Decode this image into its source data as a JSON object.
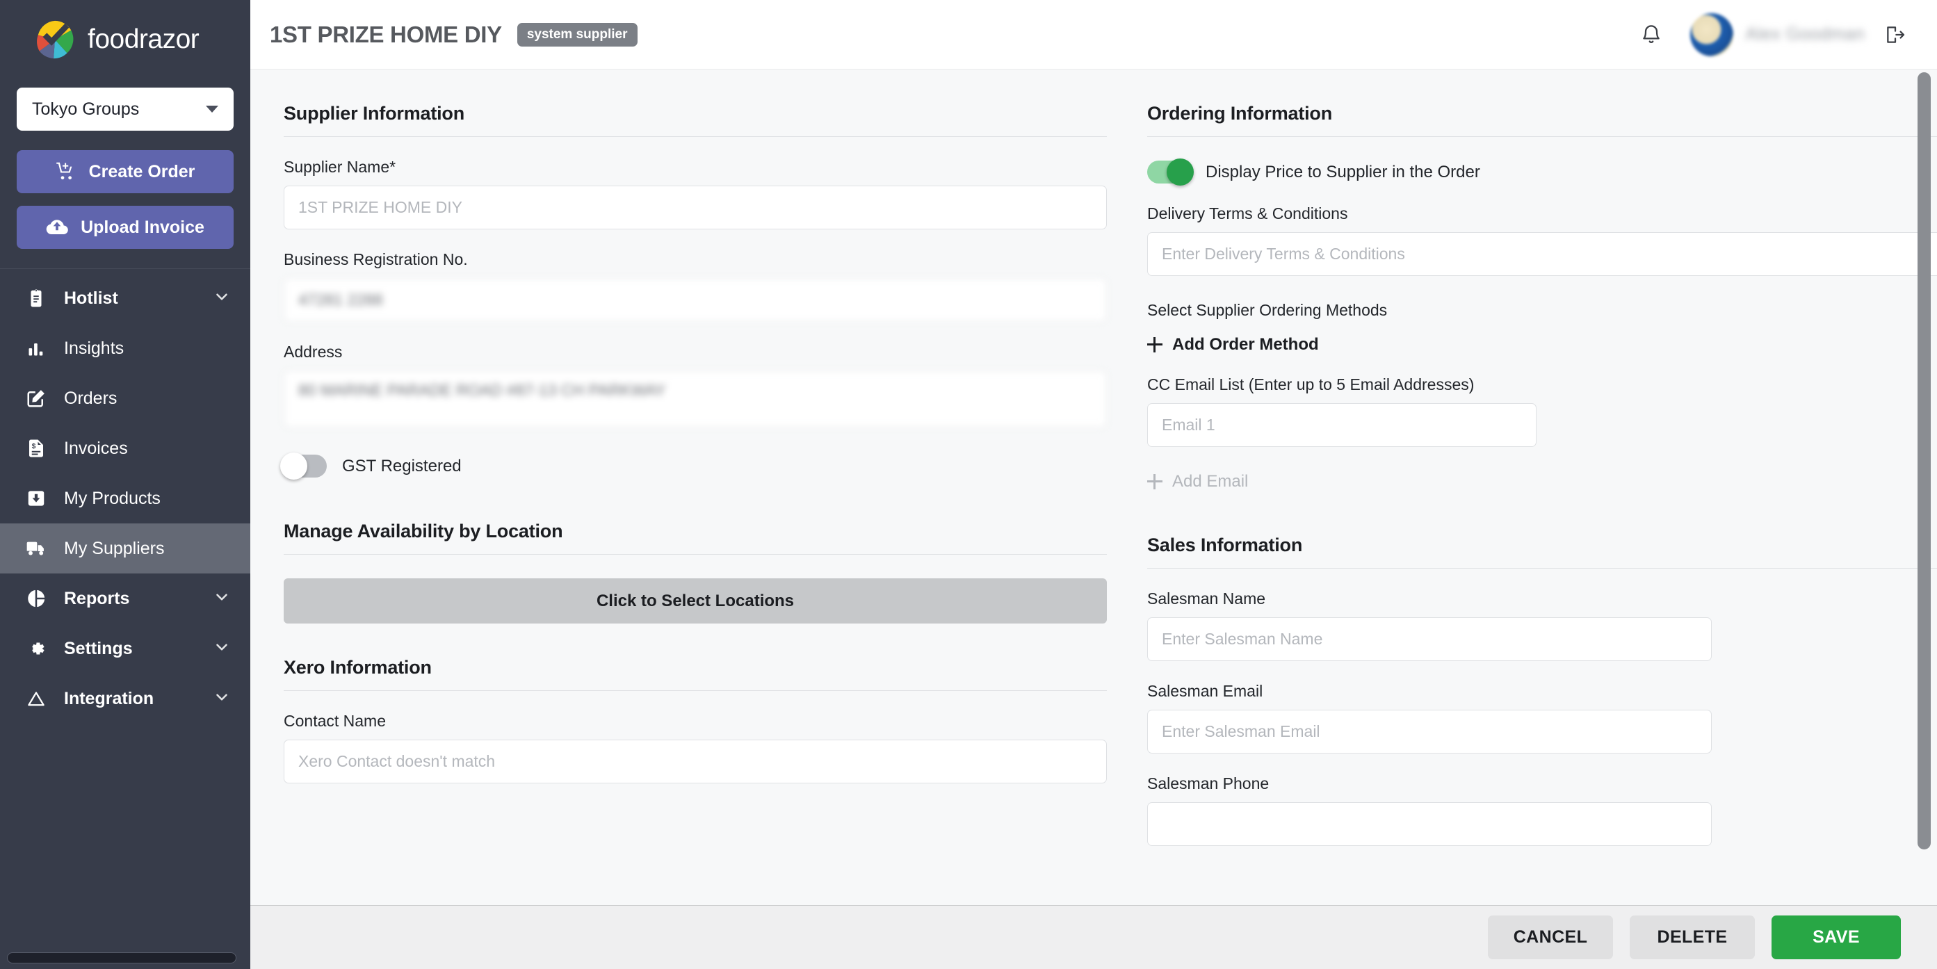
{
  "brand": {
    "name": "foodrazor",
    "logo_icon": "foodrazor-pinwheel-logo"
  },
  "sidebar": {
    "group_select": {
      "value": "Tokyo Groups",
      "caret_icon": "chevron-down-icon"
    },
    "buttons": [
      {
        "label": "Create Order",
        "icon": "cart-plus-icon"
      },
      {
        "label": "Upload Invoice",
        "icon": "cloud-upload-icon"
      }
    ],
    "items": [
      {
        "label": "Hotlist",
        "icon": "clipboard-icon",
        "expandable": true,
        "active": false
      },
      {
        "label": "Insights",
        "icon": "bar-chart-icon",
        "expandable": false,
        "active": false
      },
      {
        "label": "Orders",
        "icon": "edit-square-icon",
        "expandable": false,
        "active": false
      },
      {
        "label": "Invoices",
        "icon": "invoice-icon",
        "expandable": false,
        "active": false
      },
      {
        "label": "My Products",
        "icon": "inbox-down-icon",
        "expandable": false,
        "active": false
      },
      {
        "label": "My Suppliers",
        "icon": "truck-icon",
        "expandable": false,
        "active": true
      },
      {
        "label": "Reports",
        "icon": "pie-chart-icon",
        "expandable": true,
        "active": false
      },
      {
        "label": "Settings",
        "icon": "gear-icon",
        "expandable": true,
        "active": false
      },
      {
        "label": "Integration",
        "icon": "triangle-icon",
        "expandable": true,
        "active": false
      }
    ]
  },
  "topbar": {
    "title": "1ST PRIZE HOME DIY",
    "badge": "system supplier",
    "bell_icon": "bell-icon",
    "user_name": "Alex Goodman",
    "logout_icon": "logout-icon"
  },
  "supplier_information": {
    "heading": "Supplier Information",
    "supplier_name": {
      "label": "Supplier Name*",
      "value": "",
      "placeholder": "1ST PRIZE HOME DIY"
    },
    "business_registration": {
      "label": "Business Registration No.",
      "value": "47281 2288",
      "placeholder": ""
    },
    "address": {
      "label": "Address",
      "value": "80 MARINE PARADE ROAD #87-13 CH PARKWAY",
      "placeholder": ""
    },
    "gst_registered": {
      "label": "GST Registered",
      "state": "off"
    }
  },
  "manage_availability": {
    "heading": "Manage Availability by Location",
    "select_locations_label": "Click to Select Locations"
  },
  "xero_information": {
    "heading": "Xero Information",
    "contact_name": {
      "label": "Contact Name",
      "value": "",
      "placeholder": "Xero Contact doesn't match"
    }
  },
  "ordering_information": {
    "heading": "Ordering Information",
    "display_price_toggle": {
      "label": "Display Price to Supplier in the Order",
      "state": "on"
    },
    "delivery_terms": {
      "label": "Delivery Terms & Conditions",
      "value": "",
      "placeholder": "Enter Delivery Terms & Conditions"
    },
    "ordering_methods_label": "Select Supplier Ordering Methods",
    "add_order_method_label": "Add Order Method",
    "cc_email": {
      "label": "CC Email List (Enter up to 5 Email Addresses)",
      "value": "",
      "placeholder": "Email 1",
      "add_email_label": "Add Email"
    }
  },
  "sales_information": {
    "heading": "Sales Information",
    "salesman_name": {
      "label": "Salesman Name",
      "value": "",
      "placeholder": "Enter Salesman Name"
    },
    "salesman_email": {
      "label": "Salesman Email",
      "value": "",
      "placeholder": "Enter Salesman Email"
    },
    "salesman_phone": {
      "label": "Salesman Phone",
      "value": "",
      "placeholder": ""
    }
  },
  "actions": {
    "cancel": "CANCEL",
    "delete": "DELETE",
    "save": "SAVE"
  },
  "colors": {
    "sidebar_bg": "#373c4a",
    "sidebar_active": "#646975",
    "accent_purple": "#6065ad",
    "save_green": "#28a745",
    "toggle_on_green": "#27a04b"
  }
}
